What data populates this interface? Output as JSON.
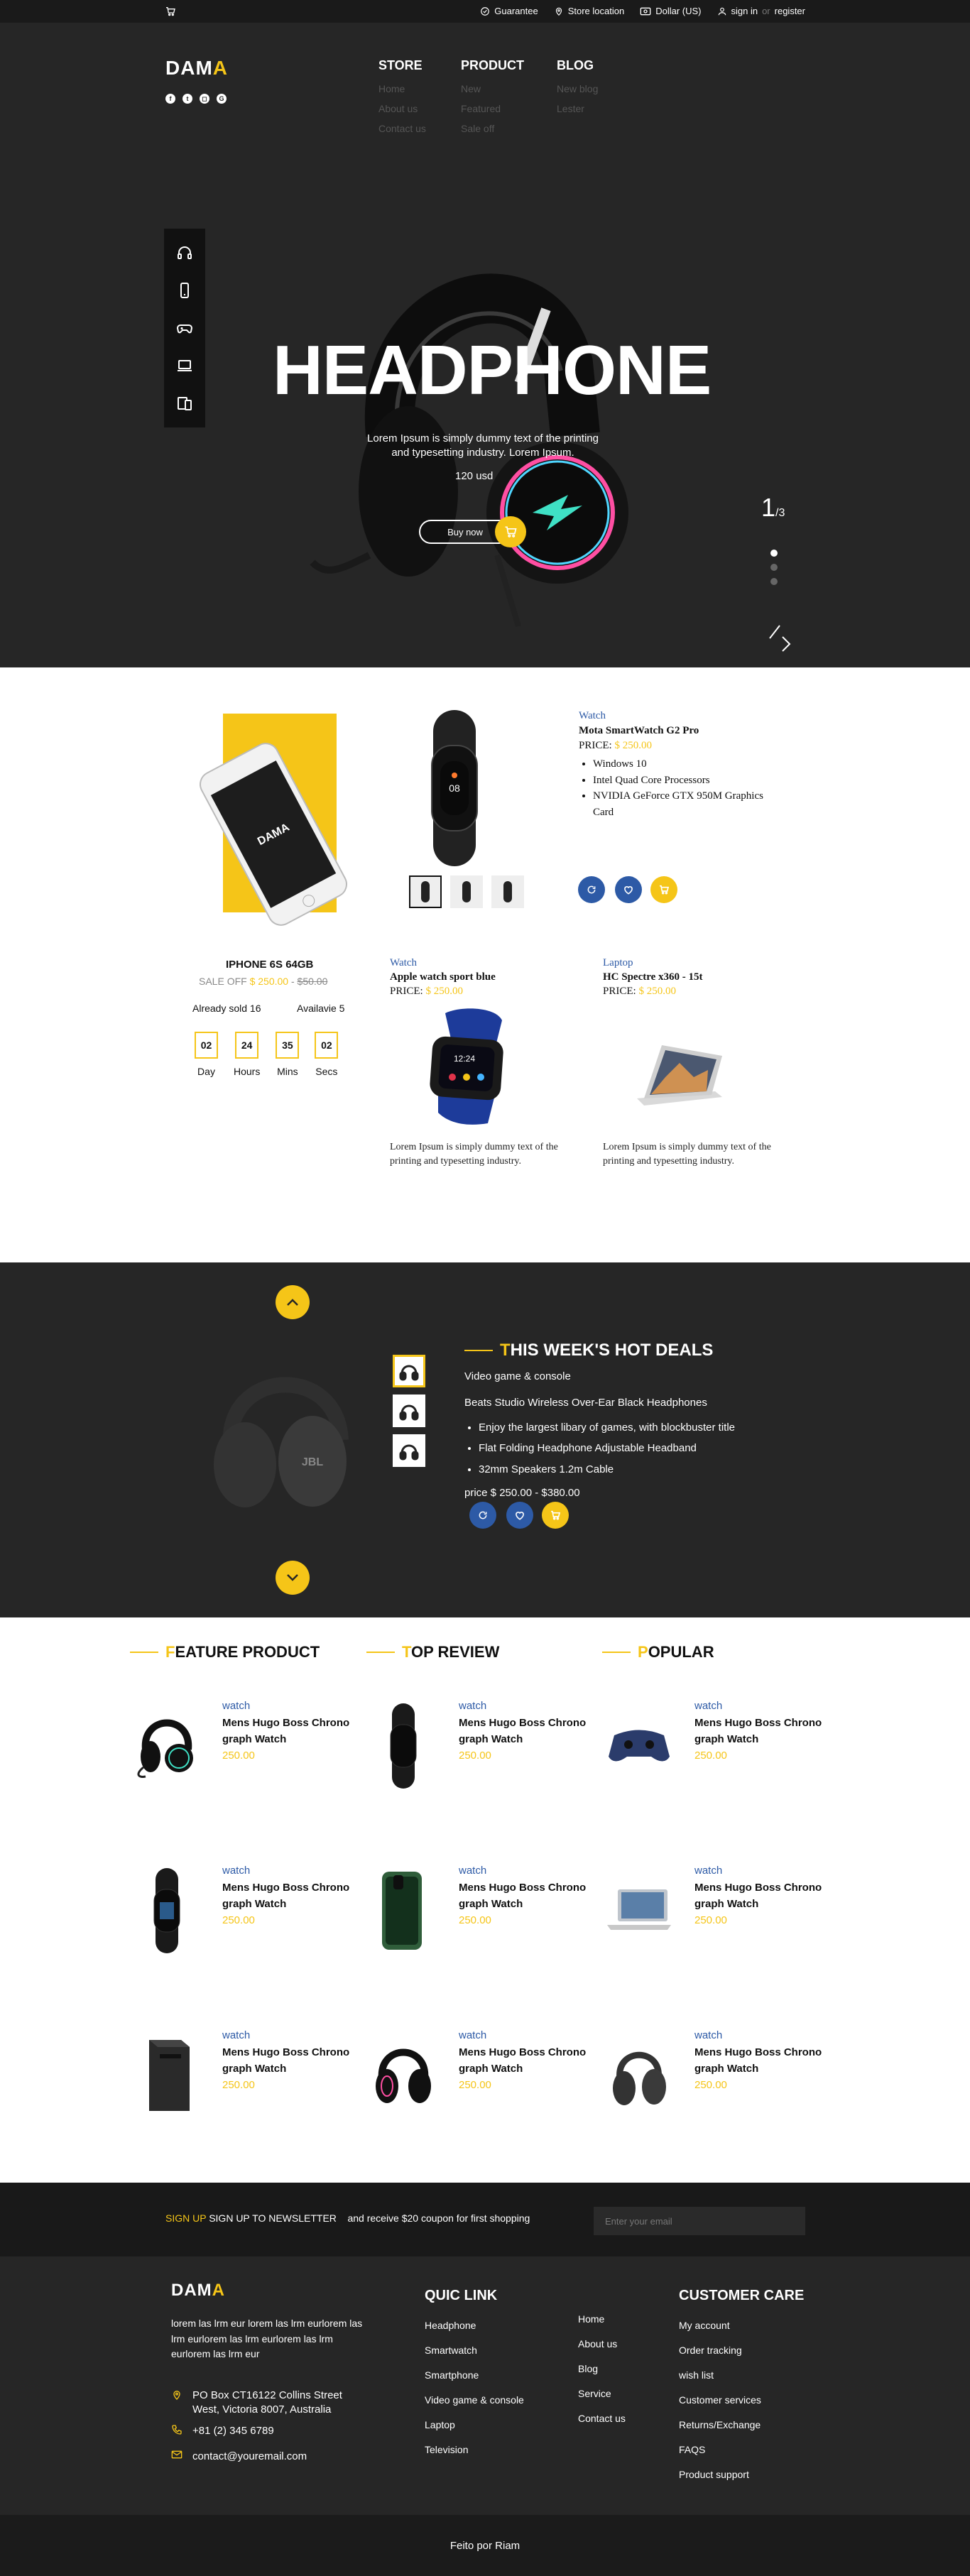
{
  "topbar": {
    "guarantee": "Guarantee",
    "store_location": "Store location",
    "currency": "Dollar (US)",
    "sign_in": "sign in",
    "or": "or",
    "register": "register"
  },
  "brand": {
    "logo_main": "DAM",
    "logo_accent": "A"
  },
  "nav": {
    "store": {
      "title": "STORE",
      "links": [
        "Home",
        "About us",
        "Contact us"
      ]
    },
    "product": {
      "title": "PRODUCT",
      "links": [
        "New",
        "Featured",
        "Sale off"
      ]
    },
    "blog": {
      "title": "BLOG",
      "links": [
        "New blog",
        "Lester"
      ]
    }
  },
  "hero": {
    "title": "HEADPHONE",
    "description": "Lorem Ipsum is simply dummy text of the printing and typesetting industry. Lorem Ipsum.",
    "price": "120 usd",
    "button": "Buy now",
    "slide_current": "1",
    "slide_total": "/3"
  },
  "featured_phone": {
    "brand_on_screen": "DAMA",
    "title": "IPHONE 6S 64GB",
    "sale_label": "SALE OFF",
    "price": "$ 250.00",
    "separator": "-",
    "old_price": "$50.00",
    "sold": "Already sold 16",
    "available": "Availavie 5",
    "timer": [
      {
        "value": "02",
        "label": "Day"
      },
      {
        "value": "24",
        "label": "Hours"
      },
      {
        "value": "35",
        "label": "Mins"
      },
      {
        "value": "02",
        "label": "Secs"
      }
    ]
  },
  "featured_watch": {
    "category": "Watch",
    "name": "Mota SmartWatch G2 Pro",
    "price_label": "PRICE:",
    "price": "$ 250.00",
    "specs": [
      "Windows 10",
      "Intel Quad Core Processors",
      "NVIDIA GeForce GTX 950M Graphics Card"
    ]
  },
  "mini_products": [
    {
      "category": "Watch",
      "name": "Apple watch sport blue",
      "price_label": "PRICE:",
      "price": "$ 250.00",
      "desc": "Lorem Ipsum is simply dummy text of the printing and typesetting industry."
    },
    {
      "category": "Laptop",
      "name": "HC Spectre x360 - 15t",
      "price_label": "PRICE:",
      "price": "$ 250.00",
      "desc": "Lorem Ipsum is simply dummy text of the printing and typesetting industry."
    }
  ],
  "deals": {
    "title_first": "T",
    "title_rest": "HIS WEEK'S HOT DEALS",
    "subtitle": "Video game & console",
    "name": "Beats Studio Wireless Over-Ear Black Headphones",
    "features": [
      "Enjoy the largest libary of games, with blockbuster title",
      "Flat Folding Headphone Adjustable Headband",
      "32mm Speakers 1.2m Cable"
    ],
    "price": "price $ 250.00 - $380.00"
  },
  "columns": [
    {
      "first": "F",
      "rest": "EATURE PRODUCT"
    },
    {
      "first": "T",
      "rest": "OP REVIEW"
    },
    {
      "first": "P",
      "rest": "OPULAR"
    }
  ],
  "list_item": {
    "category": "watch",
    "name": "Mens Hugo Boss Chrono graph Watch",
    "price": "250.00"
  },
  "newsletter": {
    "label_yellow": "SIGN UP",
    "label_white": "SIGN UP TO NEWSLETTER",
    "promo": "and receive $20 coupon for first shopping",
    "placeholder": "Enter your email"
  },
  "footer": {
    "logo_main": "DAM",
    "logo_accent": "A",
    "about": "lorem las lrm eur lorem las lrm eurlorem las lrm eurlorem las lrm eurlorem las lrm eurlorem las lrm eur",
    "address": "PO Box CT16122 Collins Street West, Victoria 8007, Australia",
    "phone": "+81 (2) 345 6789",
    "email": "contact@youremail.com",
    "quick_title": "QUIC LINK",
    "quick_links": [
      "Headphone",
      "Smartwatch",
      "Smartphone",
      "Video game & console",
      "Laptop",
      "Television"
    ],
    "pages": [
      "Home",
      "About us",
      "Blog",
      "Service",
      "Contact us"
    ],
    "care_title": "CUSTOMER CARE",
    "care_links": [
      "My account",
      "Order tracking",
      "wish list",
      "Customer services",
      "Returns/Exchange",
      "FAQS",
      "Product support"
    ],
    "copyright": "Feito por Riam"
  },
  "colors": {
    "accent": "#f5c518",
    "blue": "#2d5aa6",
    "dark": "#262626"
  }
}
